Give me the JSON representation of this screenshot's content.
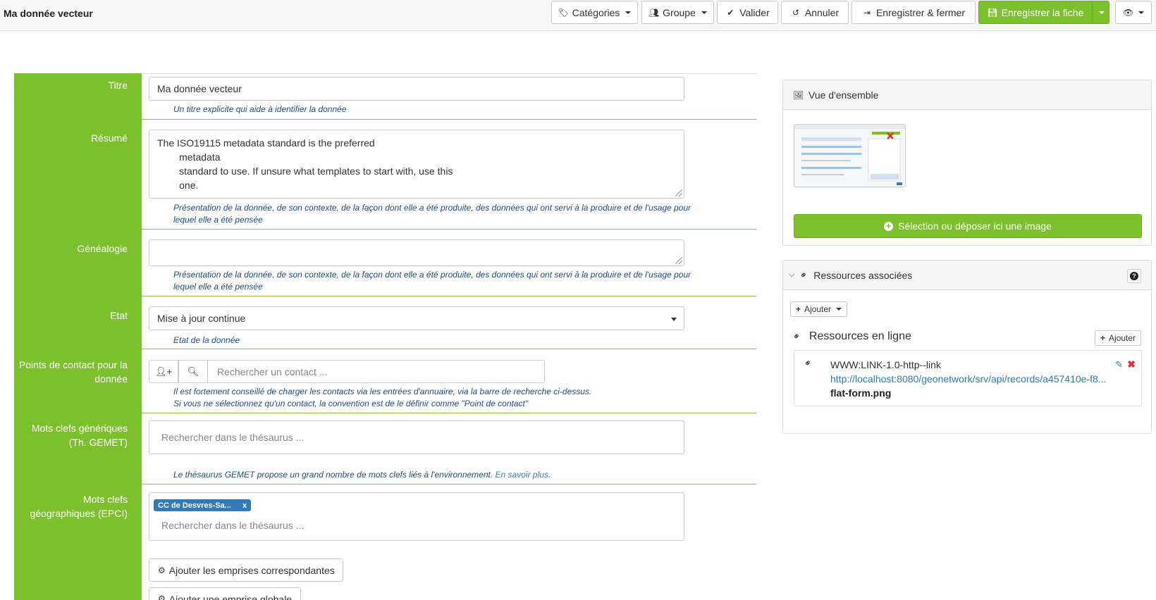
{
  "header": {
    "title": "Ma donnée vecteur",
    "buttons": {
      "categories": "Catégories",
      "groupe": "Groupe",
      "valider": "Valider",
      "annuler": "Annuler",
      "save_close": "Enregistrer & fermer",
      "save": "Enregistrer la fiche"
    }
  },
  "form": {
    "titre": {
      "label": "Titre",
      "value": "Ma donnée vecteur",
      "help": "Un titre explicite qui aide à identifier la donnée"
    },
    "resume": {
      "label": "Résumé",
      "lines": [
        "The ISO19115 metadata standard is the preferred",
        "        metadata",
        "        standard to use. If unsure what templates to start with, use this",
        "        one."
      ],
      "help": "Présentation de la donnée, de son contexte, de la façon dont elle a été produite, des données qui ont servi à la produire et de l'usage pour lequel elle a été pensée"
    },
    "genealogie": {
      "label": "Généalogie",
      "value": "",
      "help": "Présentation de la donnée, de son contexte, de la façon dont elle a été produite, des données qui ont servi à la produire et de l'usage pour lequel elle a été pensée"
    },
    "etat": {
      "label": "Etat",
      "value": "Mise à jour continue",
      "help": "Etat de la donnée"
    },
    "contacts": {
      "label": "Points de contact pour la donnée",
      "placeholder": "Rechercher un contact ...",
      "help_line1": "Il est fortement conseillé de charger les contacts via les entrées d'annuaire, via la barre de recherche ci-dessus.",
      "help_line2": "Si vous ne sélectionnez qu'un contact, la convention est de le définir comme \"Point de contact\""
    },
    "gemet": {
      "label": "Mots clefs génériques (Th. GEMET)",
      "placeholder": "Rechercher dans le thésaurus ...",
      "help": "Le thésaurus GEMET propose un grand nombre de mots clefs liés à l'environnement.",
      "help_link": "En savoir plus",
      "help_end": "."
    },
    "epci": {
      "label": "Mots clefs géographiques (EPCI)",
      "tag": "CC de Desvres-Sa...",
      "tag_remove": "x",
      "placeholder": "Rechercher dans le thésaurus ..."
    },
    "buttons": {
      "emprises": "Ajouter les emprises correspondantes",
      "emprise_globale": "Ajouter une emprise globale"
    }
  },
  "overview": {
    "title": "Vue d'ensemble",
    "upload_button": "Sélection ou déposer ici une image"
  },
  "resources": {
    "title": "Ressources associées",
    "add_label": "Ajouter",
    "online_title": "Ressources en ligne",
    "online_add": "Ajouter",
    "item": {
      "protocol": "WWW:LINK-1.0-http--link",
      "url": "http://localhost:8080/geonetwork/srv/api/records/a457410e-f8...",
      "name": "flat-form.png"
    }
  },
  "colors": {
    "green": "#7cc02e",
    "link_blue": "#337ab7",
    "help_blue": "#1f4e8c"
  }
}
